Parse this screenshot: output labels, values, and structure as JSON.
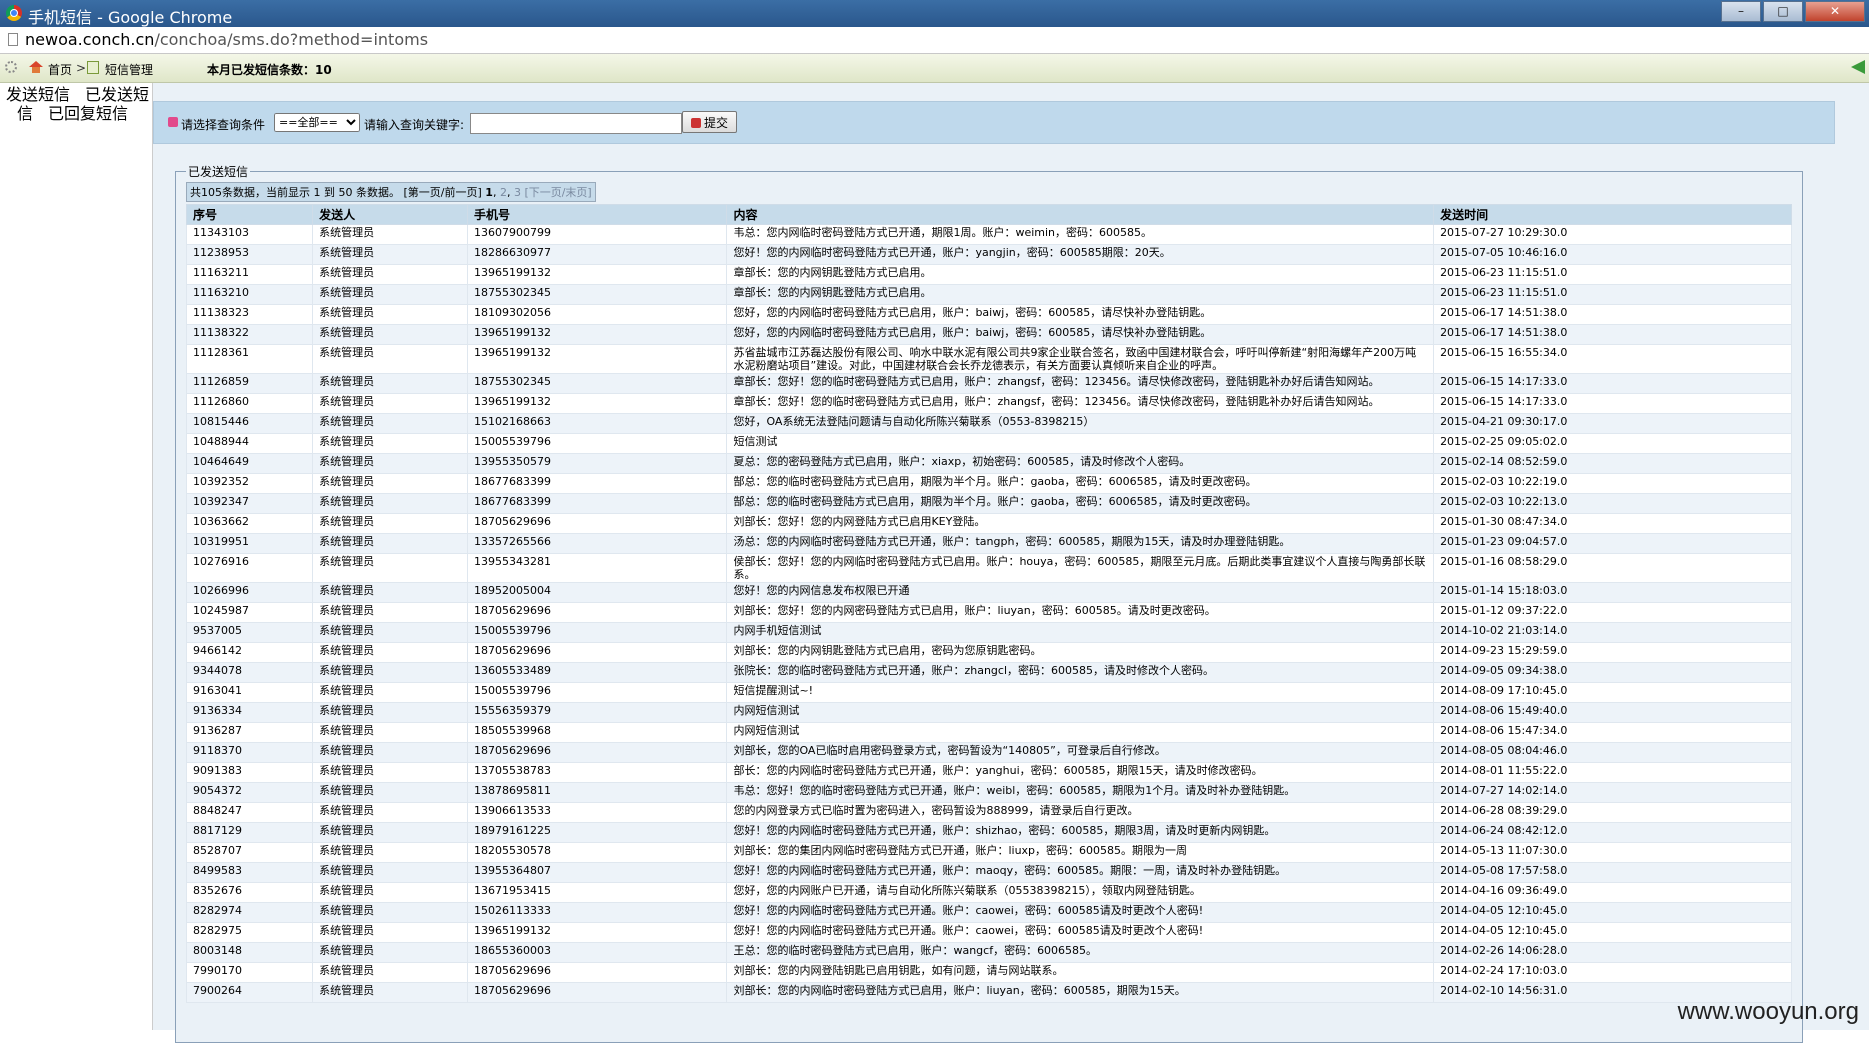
{
  "window": {
    "title": "手机短信 - Google Chrome",
    "minimize": "–",
    "maximize": "□",
    "close": "✕"
  },
  "address": {
    "domain": "newoa.conch.cn",
    "path": "/conchoa/sms.do?method=intoms"
  },
  "nav": {
    "home": "首页",
    "separator": ">",
    "section": "短信管理",
    "monthly_count": "本月已发短信条数：10"
  },
  "sidebar": {
    "items": [
      {
        "label": "发送短信"
      },
      {
        "label": "已发送短信"
      },
      {
        "label": "已回复短信"
      }
    ]
  },
  "query": {
    "condition_label": "请选择查询条件",
    "condition_value": "==全部==",
    "keyword_label": "请输入查询关键字:",
    "submit": "提交"
  },
  "panel": {
    "legend": "已发送短信"
  },
  "pager": {
    "summary": "共105条数据，当前显示 1 到 50 条数据。",
    "first_prev": "[第一页/前一页]",
    "page1": "1",
    "page2": "2",
    "page3": "3",
    "next_last": "[下一页/末页]"
  },
  "table": {
    "headers": [
      "序号",
      "发送人",
      "手机号",
      "内容",
      "发送时间"
    ],
    "rows": [
      [
        "11343103",
        "系统管理员",
        "13607900799",
        "韦总：您内网临时密码登陆方式已开通，期限1周。账户：weimin，密码：600585。",
        "2015-07-27 10:29:30.0"
      ],
      [
        "11238953",
        "系统管理员",
        "18286630977",
        "您好！您的内网临时密码登陆方式已开通，账户：yangjin，密码：600585期限：20天。",
        "2015-07-05 10:46:16.0"
      ],
      [
        "11163211",
        "系统管理员",
        "13965199132",
        "章部长：您的内网钥匙登陆方式已启用。",
        "2015-06-23 11:15:51.0"
      ],
      [
        "11163210",
        "系统管理员",
        "18755302345",
        "章部长：您的内网钥匙登陆方式已启用。",
        "2015-06-23 11:15:51.0"
      ],
      [
        "11138323",
        "系统管理员",
        "18109302056",
        "您好，您的内网临时密码登陆方式已启用，账户：baiwj，密码：600585，请尽快补办登陆钥匙。",
        "2015-06-17 14:51:38.0"
      ],
      [
        "11138322",
        "系统管理员",
        "13965199132",
        "您好，您的内网临时密码登陆方式已启用，账户：baiwj，密码：600585，请尽快补办登陆钥匙。",
        "2015-06-17 14:51:38.0"
      ],
      [
        "11128361",
        "系统管理员",
        "13965199132",
        "苏省盐城市江苏磊达股份有限公司、响水中联水泥有限公司共9家企业联合签名，致函中国建材联合会，呼吁叫停新建“射阳海螺年产200万吨水泥粉磨站项目”建设。对此，中国建材联合会长乔龙德表示，有关方面要认真倾听来自企业的呼声。",
        "2015-06-15 16:55:34.0"
      ],
      [
        "11126859",
        "系统管理员",
        "18755302345",
        "章部长：您好！您的临时密码登陆方式已启用，账户：zhangsf，密码：123456。请尽快修改密码，登陆钥匙补办好后请告知网站。",
        "2015-06-15 14:17:33.0"
      ],
      [
        "11126860",
        "系统管理员",
        "13965199132",
        "章部长：您好！您的临时密码登陆方式已启用，账户：zhangsf，密码：123456。请尽快修改密码，登陆钥匙补办好后请告知网站。",
        "2015-06-15 14:17:33.0"
      ],
      [
        "10815446",
        "系统管理员",
        "15102168663",
        "您好，OA系统无法登陆问题请与自动化所陈兴菊联系（0553-8398215）",
        "2015-04-21 09:30:17.0"
      ],
      [
        "10488944",
        "系统管理员",
        "15005539796",
        "短信测试",
        "2015-02-25 09:05:02.0"
      ],
      [
        "10464649",
        "系统管理员",
        "13955350579",
        "夏总：您的密码登陆方式已启用，账户：xiaxp，初始密码：600585，请及时修改个人密码。",
        "2015-02-14 08:52:59.0"
      ],
      [
        "10392352",
        "系统管理员",
        "18677683399",
        "郜总：您的临时密码登陆方式已启用，期限为半个月。账户：gaoba，密码：6006585，请及时更改密码。",
        "2015-02-03 10:22:19.0"
      ],
      [
        "10392347",
        "系统管理员",
        "18677683399",
        "郜总：您的临时密码登陆方式已启用，期限为半个月。账户：gaoba，密码：6006585，请及时更改密码。",
        "2015-02-03 10:22:13.0"
      ],
      [
        "10363662",
        "系统管理员",
        "18705629696",
        "刘部长：您好！您的内网登陆方式已启用KEY登陆。",
        "2015-01-30 08:47:34.0"
      ],
      [
        "10319951",
        "系统管理员",
        "13357265566",
        "汤总：您的内网临时密码登陆方式已开通，账户：tangph，密码：600585，期限为15天，请及时办理登陆钥匙。",
        "2015-01-23 09:04:57.0"
      ],
      [
        "10276916",
        "系统管理员",
        "13955343281",
        "侯部长：您好！您的内网临时密码登陆方式已启用。账户：houya，密码：600585，期限至元月底。后期此类事宜建议个人直接与陶勇部长联系。",
        "2015-01-16 08:58:29.0"
      ],
      [
        "10266996",
        "系统管理员",
        "18952005004",
        "您好！您的内网信息发布权限已开通",
        "2015-01-14 15:18:03.0"
      ],
      [
        "10245987",
        "系统管理员",
        "18705629696",
        "刘部长：您好！您的内网密码登陆方式已启用，账户：liuyan，密码：600585。请及时更改密码。",
        "2015-01-12 09:37:22.0"
      ],
      [
        "9537005",
        "系统管理员",
        "15005539796",
        "内网手机短信测试",
        "2014-10-02 21:03:14.0"
      ],
      [
        "9466142",
        "系统管理员",
        "18705629696",
        "刘部长：您的内网钥匙登陆方式已启用，密码为您原钥匙密码。",
        "2014-09-23 15:29:59.0"
      ],
      [
        "9344078",
        "系统管理员",
        "13605533489",
        "张院长：您的临时密码登陆方式已开通，账户：zhangcl，密码：600585，请及时修改个人密码。",
        "2014-09-05 09:34:38.0"
      ],
      [
        "9163041",
        "系统管理员",
        "15005539796",
        "短信提醒测试~!",
        "2014-08-09 17:10:45.0"
      ],
      [
        "9136334",
        "系统管理员",
        "15556359379",
        "内网短信测试",
        "2014-08-06 15:49:40.0"
      ],
      [
        "9136287",
        "系统管理员",
        "18505539968",
        "内网短信测试",
        "2014-08-06 15:47:34.0"
      ],
      [
        "9118370",
        "系统管理员",
        "18705629696",
        "刘部长，您的OA已临时启用密码登录方式，密码暂设为“140805”，可登录后自行修改。",
        "2014-08-05 08:04:46.0"
      ],
      [
        "9091383",
        "系统管理员",
        "13705538783",
        "部长：您的内网临时密码登陆方式已开通，账户：yanghui，密码：600585，期限15天，请及时修改密码。",
        "2014-08-01 11:55:22.0"
      ],
      [
        "9054372",
        "系统管理员",
        "13878695811",
        "韦总：您好！您的临时密码登陆方式已开通，账户：weibl，密码：600585，期限为1个月。请及时补办登陆钥匙。",
        "2014-07-27 14:02:14.0"
      ],
      [
        "8848247",
        "系统管理员",
        "13906613533",
        "您的内网登录方式已临时置为密码进入，密码暂设为888999，请登录后自行更改。",
        "2014-06-28 08:39:29.0"
      ],
      [
        "8817129",
        "系统管理员",
        "18979161225",
        "您好！您的内网临时密码登陆方式已开通，账户：shizhao，密码：600585，期限3周，请及时更新内网钥匙。",
        "2014-06-24 08:42:12.0"
      ],
      [
        "8528707",
        "系统管理员",
        "18205530578",
        "刘部长：您的集团内网临时密码登陆方式已开通，账户：liuxp，密码：600585。期限为一周",
        "2014-05-13 11:07:30.0"
      ],
      [
        "8499583",
        "系统管理员",
        "13955364807",
        "您好！您的内网临时密码登陆方式已开通，账户：maoqy，密码：600585。期限：一周，请及时补办登陆钥匙。",
        "2014-05-08 17:57:58.0"
      ],
      [
        "8352676",
        "系统管理员",
        "13671953415",
        "您好，您的内网账户已开通，请与自动化所陈兴菊联系（05538398215），领取内网登陆钥匙。",
        "2014-04-16 09:36:49.0"
      ],
      [
        "8282974",
        "系统管理员",
        "15026113333",
        "您好！您的内网临时密码登陆方式已开通。账户：caowei，密码：600585请及时更改个人密码!",
        "2014-04-05 12:10:45.0"
      ],
      [
        "8282975",
        "系统管理员",
        "13965199132",
        "您好！您的内网临时密码登陆方式已开通。账户：caowei，密码：600585请及时更改个人密码!",
        "2014-04-05 12:10:45.0"
      ],
      [
        "8003148",
        "系统管理员",
        "18655360003",
        "王总：您的临时密码登陆方式已启用，账户：wangcf，密码：6006585。",
        "2014-02-26 14:06:28.0"
      ],
      [
        "7990170",
        "系统管理员",
        "18705629696",
        "刘部长：您的内网登陆钥匙已启用钥匙，如有问题，请与网站联系。",
        "2014-02-24 17:10:03.0"
      ],
      [
        "7900264",
        "系统管理员",
        "18705629696",
        "刘部长：您的内网临时密码登陆方式已启用，账户：liuyan，密码：600585，期限为15天。",
        "2014-02-10 14:56:31.0"
      ]
    ]
  },
  "watermark": "www.wooyun.org"
}
